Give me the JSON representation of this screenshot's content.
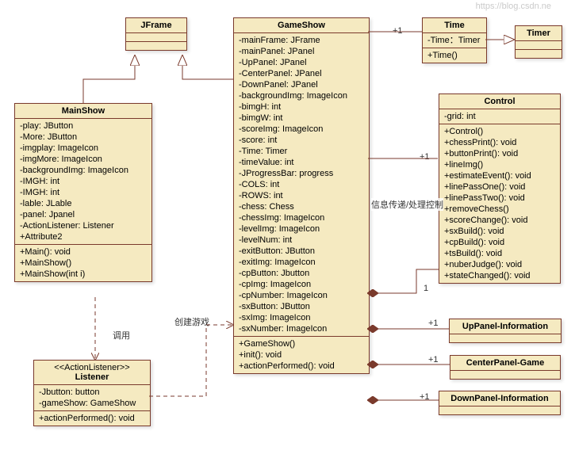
{
  "jframe": {
    "title": "JFrame"
  },
  "mainshow": {
    "title": "MainShow",
    "attrs": [
      "-play: JButton",
      "-More: JButton",
      "-imgplay: ImageIcon",
      "-imgMore: ImageIcon",
      "-backgroundImg: ImageIcon",
      "-IMGH: int",
      "-IMGH: int",
      "-lable: JLable",
      "-panel: Jpanel",
      "-ActionListener: Listener",
      "+Attribute2"
    ],
    "ops": [
      "+Main(): void",
      "+MainShow()",
      "+MainShow(int i)"
    ]
  },
  "listener": {
    "stereo": "<<ActionListener>>",
    "title": "Listener",
    "attrs": [
      "-Jbutton: button",
      "-gameShow: GameShow"
    ],
    "ops": [
      "+actionPerformed(): void"
    ]
  },
  "gameshow": {
    "title": "GameShow",
    "attrs": [
      "-mainFrame: JFrame",
      "-mainPanel: JPanel",
      "-UpPanel: JPanel",
      "-CenterPanel: JPanel",
      "-DownPanel: JPanel",
      "-backgroundImg: ImageIcon",
      "-bimgH: int",
      "-bimgW: int",
      "-scoreImg: ImageIcon",
      "-score: int",
      "-Time: Timer",
      "-timeValue: int",
      "-JProgressBar: progress",
      "-COLS: int",
      "-ROWS: int",
      "-chess: Chess",
      "-chessImg: ImageIcon",
      "-levelImg: ImageIcon",
      "-levelNum: int",
      "-exitButton: JButton",
      "-exitImg: ImageIcon",
      "-cpButton: Jbutton",
      "-cpImg: ImageIcon",
      "-cpNumber: ImageIcon",
      "-sxButton: JButton",
      "-sxImg: ImageIcon",
      "-sxNumber: ImageIcon"
    ],
    "ops": [
      "+GameShow()",
      "+init(): void",
      "+actionPerformed(): void"
    ]
  },
  "time": {
    "title": "Time",
    "attrs": [
      "-Time：Timer"
    ],
    "ops": [
      "+Time()"
    ]
  },
  "timer": {
    "title": "Timer"
  },
  "control": {
    "title": "Control",
    "attrs": [
      "-grid: int"
    ],
    "ops": [
      "+Control()",
      "+chessPrint(): void",
      "+buttonPrint(): void",
      "+lineImg()",
      "+estimateEvent(): void",
      "+linePassOne(): void",
      "+linePassTwo(): void",
      "+removeChess()",
      "+scoreChange(): void",
      "+sxBuild(): void",
      "+cpBuild(): void",
      "+tsBuild(): void",
      "+nuberJudge(): void",
      "+stateChanged(): void"
    ]
  },
  "up": {
    "title": "UpPanel-Information"
  },
  "center": {
    "title": "CenterPanel-Game"
  },
  "down": {
    "title": "DownPanel-Information"
  },
  "labels": {
    "call": "调用",
    "create": "创建游戏",
    "msg": "信息传递/处理控制",
    "p1a": "+1",
    "p1b": "+1",
    "p1c": "+1",
    "p1d": "+1",
    "p1e": "+1",
    "one": "1"
  },
  "watermark": "https://blog.csdn.ne"
}
